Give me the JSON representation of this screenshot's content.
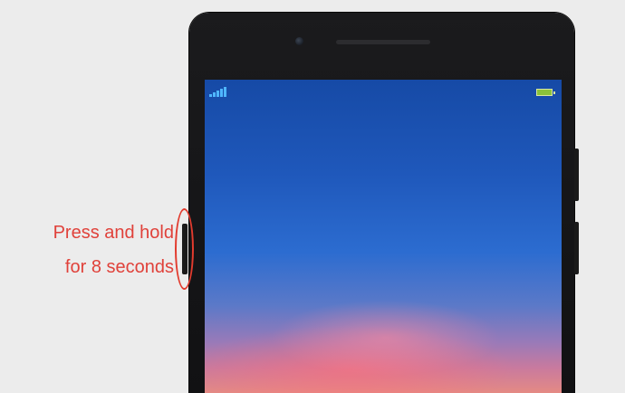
{
  "instruction": {
    "line1": "Press and hold",
    "line2": "for 8 seconds"
  },
  "colors": {
    "accent": "#e0413a",
    "signal": "#4fb6ff",
    "battery": "#8ac23a"
  },
  "icons": {
    "signal": "signal-strength-icon",
    "battery": "battery-icon",
    "camera": "front-camera-icon"
  }
}
